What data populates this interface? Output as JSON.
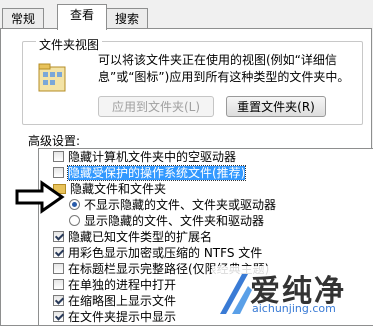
{
  "tabs": [
    "常规",
    "查看",
    "搜索"
  ],
  "folder_view": {
    "title": "文件夹视图",
    "description": "可以将该文件夹正在使用的视图(例如“详细信息”或“图标”)应用到所有这种类型的文件夹中。",
    "apply_button": "应用到文件夹(L)",
    "reset_button": "重置文件夹(R)"
  },
  "advanced": {
    "label": "高级设置:",
    "items": [
      {
        "type": "checkbox",
        "checked": false,
        "label": "隐藏计算机文件夹中的空驱动器"
      },
      {
        "type": "checkbox",
        "checked": false,
        "label": "隐藏受保护的操作系统文件(推荐)",
        "selected": true
      },
      {
        "type": "folder",
        "label": "隐藏文件和文件夹"
      },
      {
        "type": "radio",
        "checked": true,
        "label": "不显示隐藏的文件、文件夹或驱动器"
      },
      {
        "type": "radio",
        "checked": false,
        "label": "显示隐藏的文件、文件夹和驱动器"
      },
      {
        "type": "checkbox",
        "checked": true,
        "label": "隐藏已知文件类型的扩展名"
      },
      {
        "type": "checkbox",
        "checked": true,
        "label": "用彩色显示加密或压缩的 NTFS 文件"
      },
      {
        "type": "checkbox",
        "checked": false,
        "label": "在标题栏显示完整路径(仅限经典主题)"
      },
      {
        "type": "checkbox",
        "checked": false,
        "label": "在单独的进程中打开"
      },
      {
        "type": "checkbox",
        "checked": true,
        "label": "在缩略图上显示文件"
      },
      {
        "type": "checkbox",
        "checked": true,
        "label": "在文件夹提示中显示"
      },
      {
        "type": "checkbox",
        "checked": true,
        "label": "在预览窗格中显示"
      }
    ]
  },
  "watermark": {
    "text": "爱纯净",
    "url": "aichunjing.com"
  },
  "colors": {
    "selection": "#3399ff",
    "folder": "#e8c25a",
    "accent": "#3a7bd5"
  }
}
